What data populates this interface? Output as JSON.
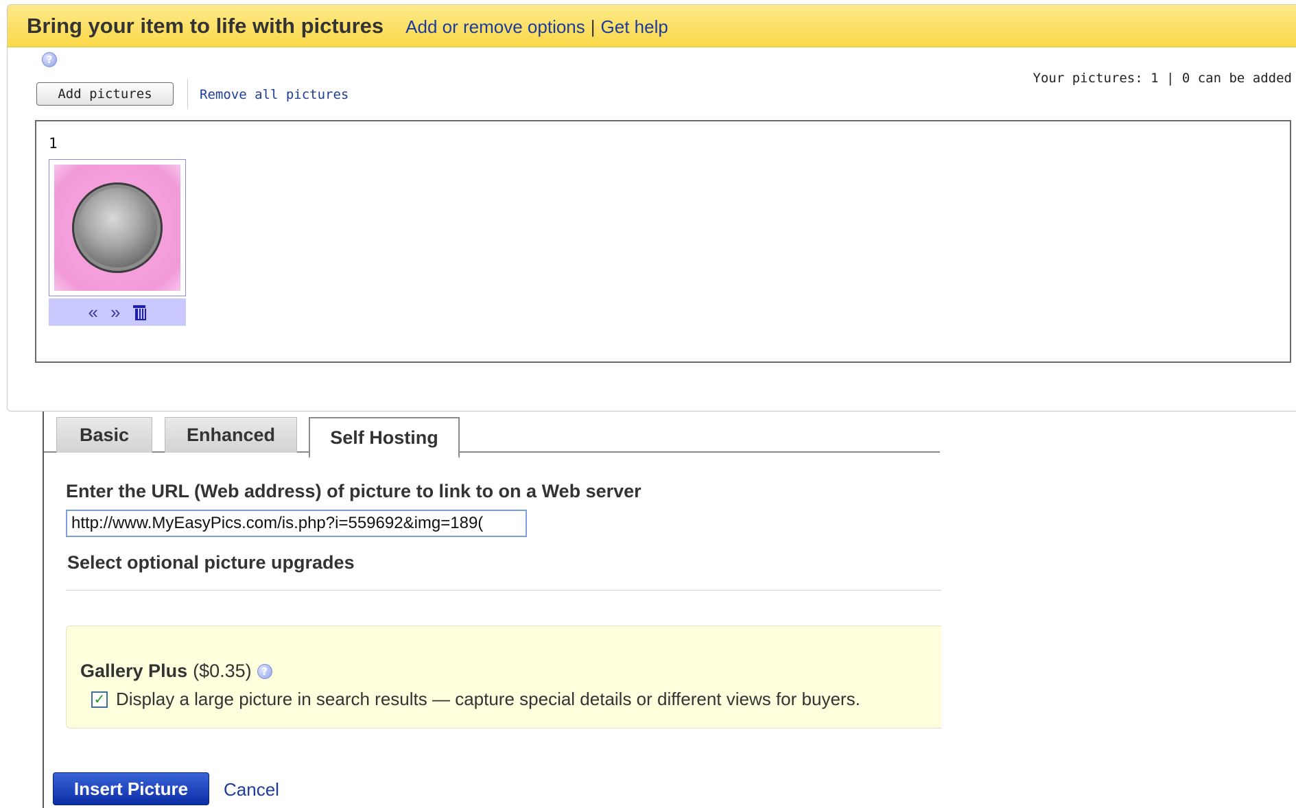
{
  "panel": {
    "title": "Bring your item to life with pictures",
    "header_links": {
      "add_remove": "Add or remove options",
      "separator": "|",
      "get_help": "Get help"
    },
    "help_icon_glyph": "?",
    "add_pictures_label": "Add pictures",
    "remove_all_label": "Remove all pictures",
    "your_pictures_text": "Your pictures: 1 | 0 can be added",
    "pictures": [
      {
        "index": "1",
        "description": "",
        "controls": {
          "move_left": "«",
          "move_right": "»"
        }
      }
    ]
  },
  "tabs": [
    {
      "label": "Basic",
      "active": false
    },
    {
      "label": "Enhanced",
      "active": false
    },
    {
      "label": "Self Hosting",
      "active": true
    }
  ],
  "self_hosting": {
    "url_label": "Enter the URL (Web address) of picture to link to on a Web server",
    "url_value": "http://www.MyEasyPics.com/is.php?i=559692&img=189(",
    "upgrades_label": "Select optional picture upgrades",
    "gallery_plus": {
      "title": "Gallery Plus",
      "price": "($0.35)",
      "checkbox_label": "Display a large picture in search results — capture special details or different views for buyers.",
      "checked": true
    }
  },
  "actions": {
    "insert_label": "Insert Picture",
    "cancel_label": "Cancel"
  },
  "colors": {
    "header_yellow": "#fbd94a",
    "link_blue": "#1d3c9a",
    "insert_button_blue": "#0c2da6",
    "gallery_background": "#ffffde",
    "thumb_pink": "#f29ad8"
  },
  "icons": {
    "help": "help-icon",
    "trash": "trash-icon",
    "checkbox": "checkbox-checked-icon"
  }
}
